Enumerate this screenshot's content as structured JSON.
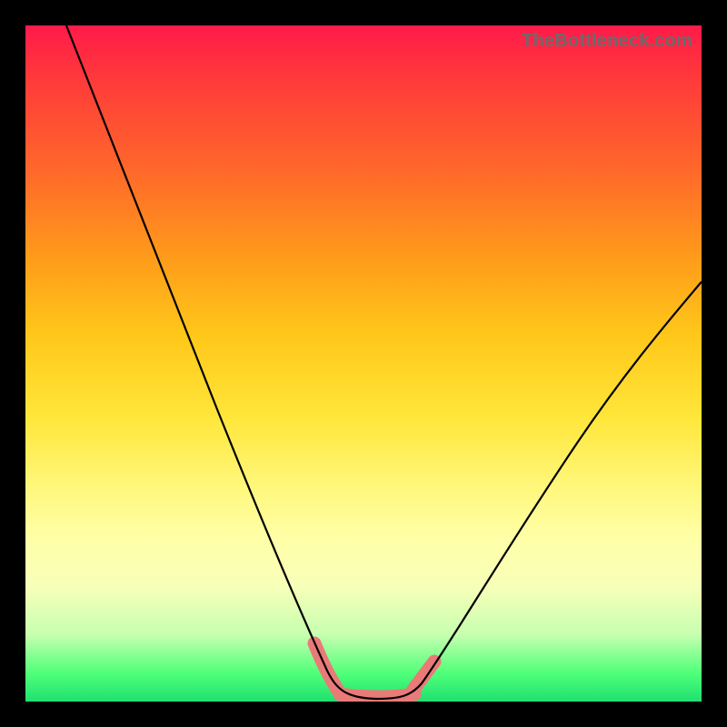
{
  "watermark": "TheBottleneck.com",
  "chart_data": {
    "type": "line",
    "title": "",
    "xlabel": "",
    "ylabel": "",
    "xlim": [
      0,
      100
    ],
    "ylim": [
      0,
      100
    ],
    "grid": false,
    "legend": false,
    "series": [
      {
        "name": "left-descent",
        "x": [
          6,
          10,
          15,
          20,
          25,
          30,
          35,
          40,
          43,
          46
        ],
        "values": [
          100,
          89,
          77,
          64,
          52,
          40,
          28,
          14,
          6,
          1
        ]
      },
      {
        "name": "valley-floor",
        "x": [
          46,
          49,
          52,
          55,
          58
        ],
        "values": [
          1,
          0.3,
          0.3,
          0.4,
          1
        ]
      },
      {
        "name": "right-ascent",
        "x": [
          58,
          62,
          66,
          72,
          78,
          85,
          92,
          100
        ],
        "values": [
          1,
          5,
          12,
          22,
          32,
          43,
          53,
          62
        ]
      }
    ],
    "annotations": [
      {
        "name": "highlight-left-bottom",
        "x_range": [
          42.5,
          46.5
        ],
        "y_range": [
          0,
          8
        ],
        "color": "#e97a78"
      },
      {
        "name": "highlight-floor",
        "x_range": [
          46,
          58
        ],
        "y_range": [
          0,
          1.8
        ],
        "color": "#e97a78"
      },
      {
        "name": "highlight-right-bottom",
        "x_range": [
          57,
          60.5
        ],
        "y_range": [
          0,
          5
        ],
        "color": "#e97a78"
      }
    ],
    "background_gradient": {
      "direction": "vertical",
      "stops": [
        {
          "pct": 0,
          "color": "#ff1a4a"
        },
        {
          "pct": 46,
          "color": "#ffc81a"
        },
        {
          "pct": 76,
          "color": "#ffffa8"
        },
        {
          "pct": 100,
          "color": "#20e070"
        }
      ]
    }
  }
}
